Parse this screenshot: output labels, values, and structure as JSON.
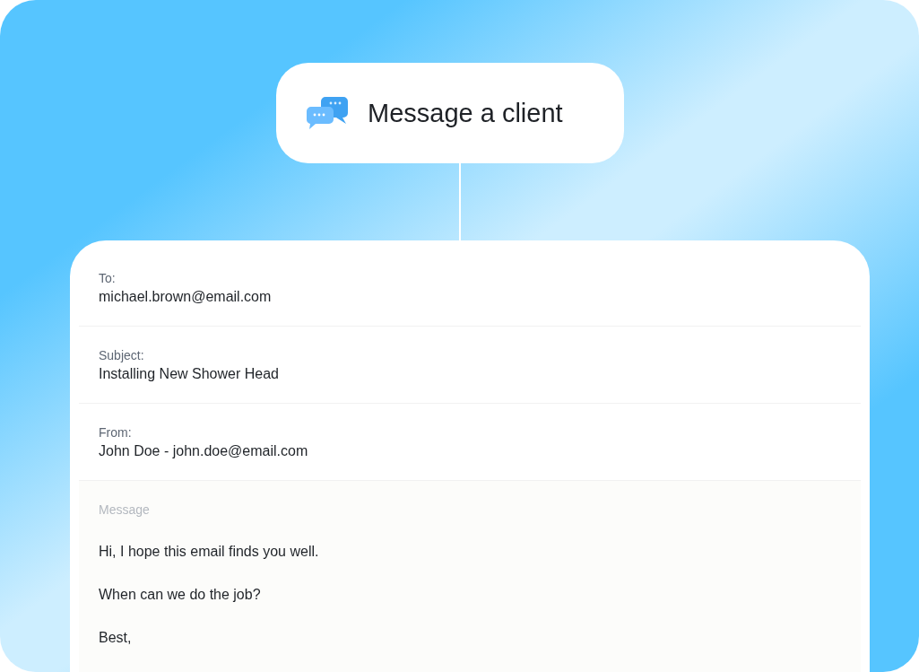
{
  "header": {
    "title": "Message a client"
  },
  "fields": [
    {
      "label": "To:",
      "value": "michael.brown@email.com"
    },
    {
      "label": "Subject:",
      "value": "Installing New Shower Head"
    },
    {
      "label": "From:",
      "value": "John Doe - john.doe@email.com"
    }
  ],
  "message": {
    "label": "Message",
    "lines": [
      "Hi, I hope this email finds you well.",
      "When can we do the job?",
      "Best,"
    ]
  }
}
